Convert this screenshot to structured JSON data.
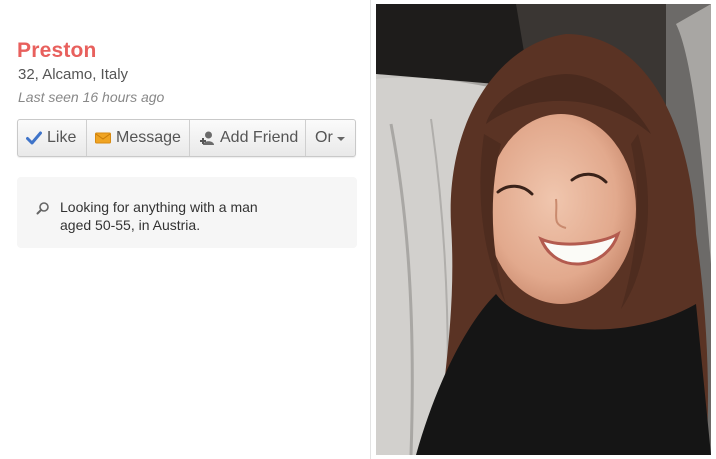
{
  "profile": {
    "name": "Preston",
    "meta": "32, Alcamo, Italy",
    "last_seen": "Last seen 16 hours ago"
  },
  "actions": {
    "like_label": "Like",
    "message_label": "Message",
    "add_friend_label": "Add Friend",
    "or_label": "Or"
  },
  "looking_for": {
    "text": "Looking for anything with a man aged 50-55, in Austria."
  },
  "colors": {
    "name": "#e8605d",
    "like_check": "#3f74c9",
    "message_envelope": "#f0a422",
    "panel_bg": "#f6f6f6"
  },
  "icons": {
    "like": "checkmark-icon",
    "message": "envelope-icon",
    "add_friend": "add-friend-icon",
    "or": "caret-down-icon",
    "looking_for": "search-icon"
  }
}
